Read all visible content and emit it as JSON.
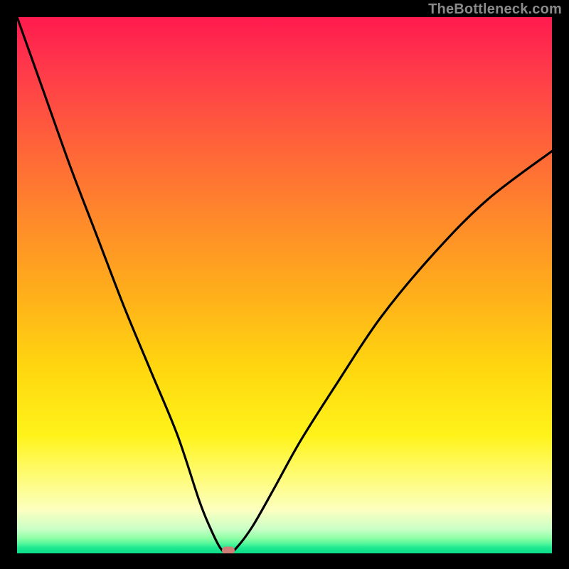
{
  "watermark": "TheBottleneck.com",
  "chart_data": {
    "type": "line",
    "title": "",
    "xlabel": "",
    "ylabel": "",
    "xlim": [
      0,
      100
    ],
    "ylim": [
      0,
      100
    ],
    "grid": false,
    "series": [
      {
        "name": "bottleneck-curve",
        "x": [
          0,
          5,
          10,
          15,
          20,
          25,
          30,
          34,
          36,
          38,
          39.5,
          41,
          44,
          48,
          53,
          60,
          68,
          78,
          88,
          100
        ],
        "y": [
          100,
          86,
          72,
          59,
          46,
          34,
          22,
          10,
          5,
          1,
          0,
          1,
          5,
          12,
          21,
          32,
          44,
          56,
          66,
          75
        ]
      }
    ],
    "marker": {
      "x": 39.5,
      "y": 0,
      "color": "#cf7f75"
    },
    "gradient_stops": [
      {
        "pos": 0,
        "color": "#ff1a4f"
      },
      {
        "pos": 0.25,
        "color": "#ff6638"
      },
      {
        "pos": 0.52,
        "color": "#ffb01a"
      },
      {
        "pos": 0.78,
        "color": "#fff31a"
      },
      {
        "pos": 0.92,
        "color": "#fbffc0"
      },
      {
        "pos": 0.97,
        "color": "#8effa6"
      },
      {
        "pos": 1.0,
        "color": "#09df89"
      }
    ]
  }
}
